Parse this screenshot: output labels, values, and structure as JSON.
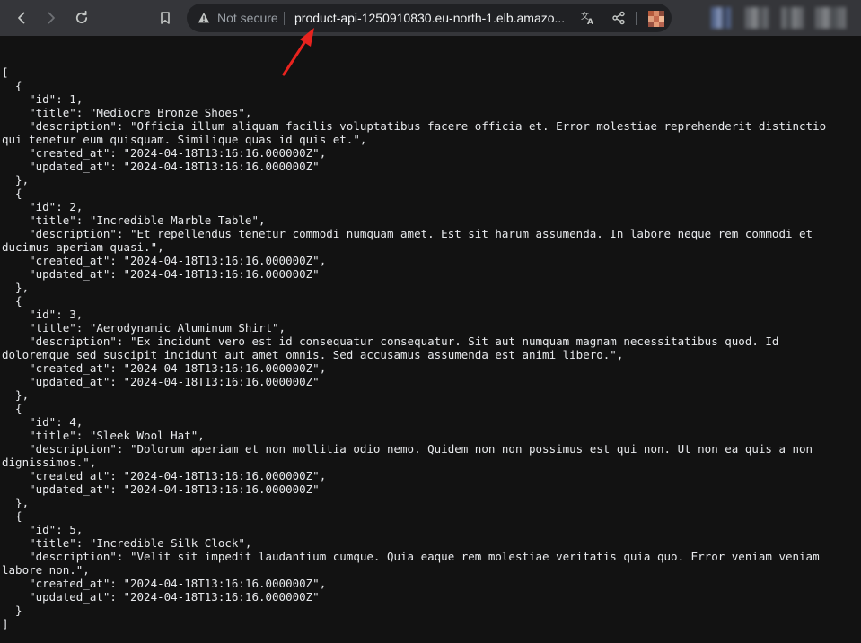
{
  "browser": {
    "security_status": "Not secure",
    "url": "product-api-1250910830.eu-north-1.elb.amazo..."
  },
  "icons": {
    "back": "arrow-left-icon",
    "forward": "arrow-right-icon",
    "reload": "reload-icon",
    "bookmark": "bookmark-icon",
    "warning": "warning-triangle-icon",
    "translate": "translate-icon",
    "share": "share-icon"
  },
  "colors": {
    "toolbar": "#35363a",
    "omnibox": "#202124",
    "page": "#121212",
    "text": "#e8eaed",
    "annotation_arrow": "#e8231e"
  },
  "json_lines": [
    "[",
    "  {",
    "    \"id\": 1,",
    "    \"title\": \"Mediocre Bronze Shoes\",",
    "    \"description\": \"Officia illum aliquam facilis voluptatibus facere officia et. Error molestiae reprehenderit distinctio",
    "qui tenetur eum quisquam. Similique quas id quis et.\",",
    "    \"created_at\": \"2024-04-18T13:16:16.000000Z\",",
    "    \"updated_at\": \"2024-04-18T13:16:16.000000Z\"",
    "  },",
    "  {",
    "    \"id\": 2,",
    "    \"title\": \"Incredible Marble Table\",",
    "    \"description\": \"Et repellendus tenetur commodi numquam amet. Est sit harum assumenda. In labore neque rem commodi et",
    "ducimus aperiam quasi.\",",
    "    \"created_at\": \"2024-04-18T13:16:16.000000Z\",",
    "    \"updated_at\": \"2024-04-18T13:16:16.000000Z\"",
    "  },",
    "  {",
    "    \"id\": 3,",
    "    \"title\": \"Aerodynamic Aluminum Shirt\",",
    "    \"description\": \"Ex incidunt vero est id consequatur consequatur. Sit aut numquam magnam necessitatibus quod. Id",
    "doloremque sed suscipit incidunt aut amet omnis. Sed accusamus assumenda est animi libero.\",",
    "    \"created_at\": \"2024-04-18T13:16:16.000000Z\",",
    "    \"updated_at\": \"2024-04-18T13:16:16.000000Z\"",
    "  },",
    "  {",
    "    \"id\": 4,",
    "    \"title\": \"Sleek Wool Hat\",",
    "    \"description\": \"Dolorum aperiam et non mollitia odio nemo. Quidem non non possimus est qui non. Ut non ea quis a non",
    "dignissimos.\",",
    "    \"created_at\": \"2024-04-18T13:16:16.000000Z\",",
    "    \"updated_at\": \"2024-04-18T13:16:16.000000Z\"",
    "  },",
    "  {",
    "    \"id\": 5,",
    "    \"title\": \"Incredible Silk Clock\",",
    "    \"description\": \"Velit sit impedit laudantium cumque. Quia eaque rem molestiae veritatis quia quo. Error veniam veniam",
    "labore non.\",",
    "    \"created_at\": \"2024-04-18T13:16:16.000000Z\",",
    "    \"updated_at\": \"2024-04-18T13:16:16.000000Z\"",
    "  }",
    "]"
  ]
}
